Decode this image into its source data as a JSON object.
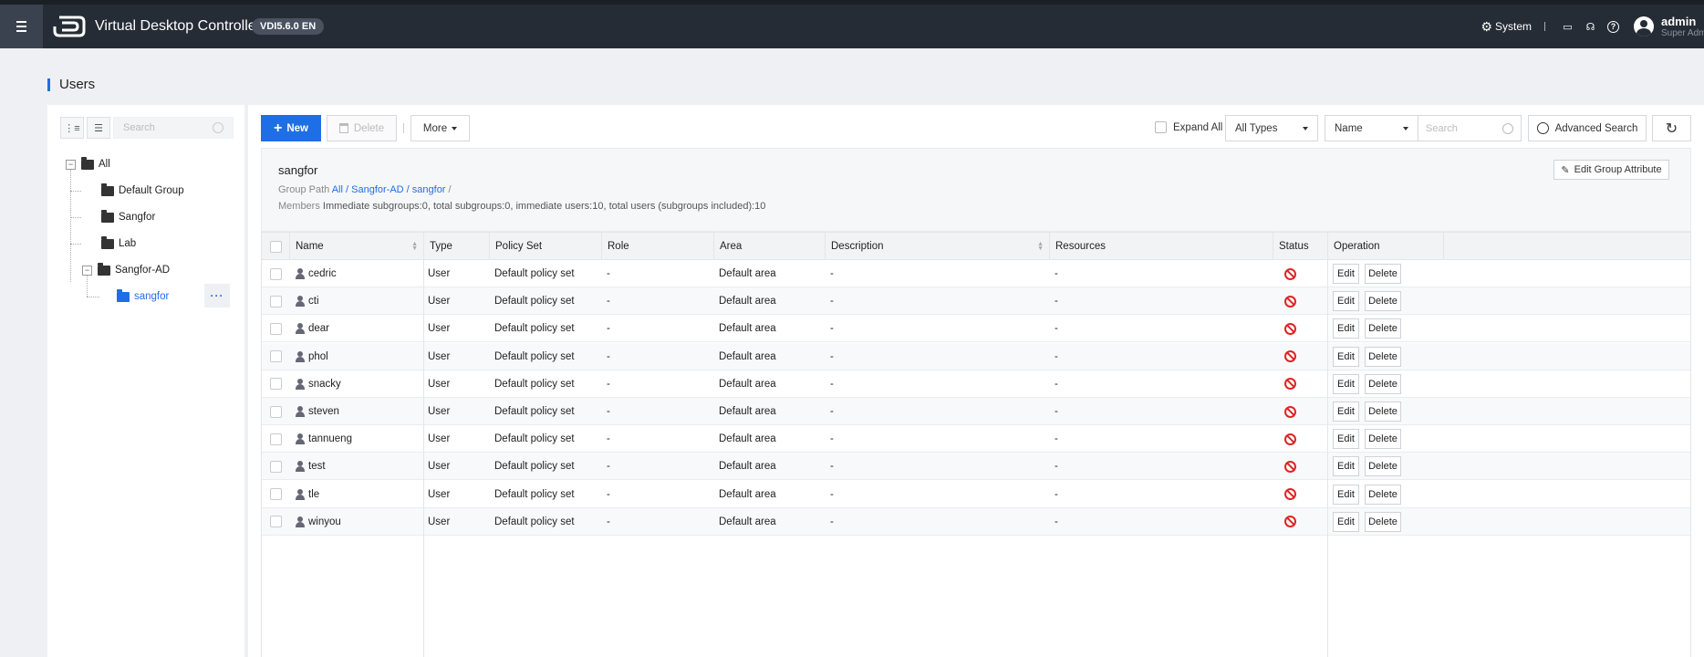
{
  "topbar": {
    "app_title": "Virtual Desktop Controller",
    "version": "VDI5.6.0 EN",
    "system_label": "System",
    "user_name": "admin",
    "user_role": "Super Admin"
  },
  "page_title": "Users",
  "tree": {
    "search_placeholder": "Search",
    "nodes": {
      "all": "All",
      "default_group": "Default Group",
      "sangfor": "Sangfor",
      "lab": "Lab",
      "sangfor_ad": "Sangfor-AD",
      "sangfor_child": "sangfor"
    },
    "more_label": "···"
  },
  "toolbar": {
    "new_label": "New",
    "delete_label": "Delete",
    "more_label": "More",
    "expand_all_label": "Expand All",
    "type_filter": "All Types",
    "field_filter": "Name",
    "search_placeholder": "Search",
    "advanced_search_label": "Advanced Search",
    "refresh_icon": "↻"
  },
  "group_info": {
    "name": "sangfor",
    "path_label": "Group Path",
    "path": [
      "All",
      "Sangfor-AD",
      "sangfor"
    ],
    "path_sep": " / ",
    "path_trailing": " /",
    "members_label": "Members",
    "members_text": "Immediate subgroups:0, total subgroups:0, immediate users:10, total users (subgroups included):10",
    "edit_attr_label": "Edit Group Attribute"
  },
  "table": {
    "columns": {
      "name": "Name",
      "type": "Type",
      "policy_set": "Policy Set",
      "role": "Role",
      "area": "Area",
      "description": "Description",
      "resources": "Resources",
      "status": "Status",
      "operation": "Operation",
      "more": "···"
    },
    "edit_label": "Edit",
    "delete_label": "Delete",
    "rows": [
      {
        "name": "cedric",
        "type": "User",
        "policy": "Default policy set",
        "role": "-",
        "area": "Default area",
        "description": "-",
        "resources": "-",
        "status": "disabled"
      },
      {
        "name": "cti",
        "type": "User",
        "policy": "Default policy set",
        "role": "-",
        "area": "Default area",
        "description": "-",
        "resources": "-",
        "status": "disabled"
      },
      {
        "name": "dear",
        "type": "User",
        "policy": "Default policy set",
        "role": "-",
        "area": "Default area",
        "description": "-",
        "resources": "-",
        "status": "disabled"
      },
      {
        "name": "phol",
        "type": "User",
        "policy": "Default policy set",
        "role": "-",
        "area": "Default area",
        "description": "-",
        "resources": "-",
        "status": "disabled"
      },
      {
        "name": "snacky",
        "type": "User",
        "policy": "Default policy set",
        "role": "-",
        "area": "Default area",
        "description": "-",
        "resources": "-",
        "status": "disabled"
      },
      {
        "name": "steven",
        "type": "User",
        "policy": "Default policy set",
        "role": "-",
        "area": "Default area",
        "description": "-",
        "resources": "-",
        "status": "disabled"
      },
      {
        "name": "tannueng",
        "type": "User",
        "policy": "Default policy set",
        "role": "-",
        "area": "Default area",
        "description": "-",
        "resources": "-",
        "status": "disabled"
      },
      {
        "name": "test",
        "type": "User",
        "policy": "Default policy set",
        "role": "-",
        "area": "Default area",
        "description": "-",
        "resources": "-",
        "status": "disabled"
      },
      {
        "name": "tle",
        "type": "User",
        "policy": "Default policy set",
        "role": "-",
        "area": "Default area",
        "description": "-",
        "resources": "-",
        "status": "disabled"
      },
      {
        "name": "winyou",
        "type": "User",
        "policy": "Default policy set",
        "role": "-",
        "area": "Default area",
        "description": "-",
        "resources": "-",
        "status": "disabled"
      }
    ]
  },
  "colors": {
    "accent": "#1e6fe6",
    "topbar_bg": "#262c36",
    "status_disabled": "#e02424"
  }
}
